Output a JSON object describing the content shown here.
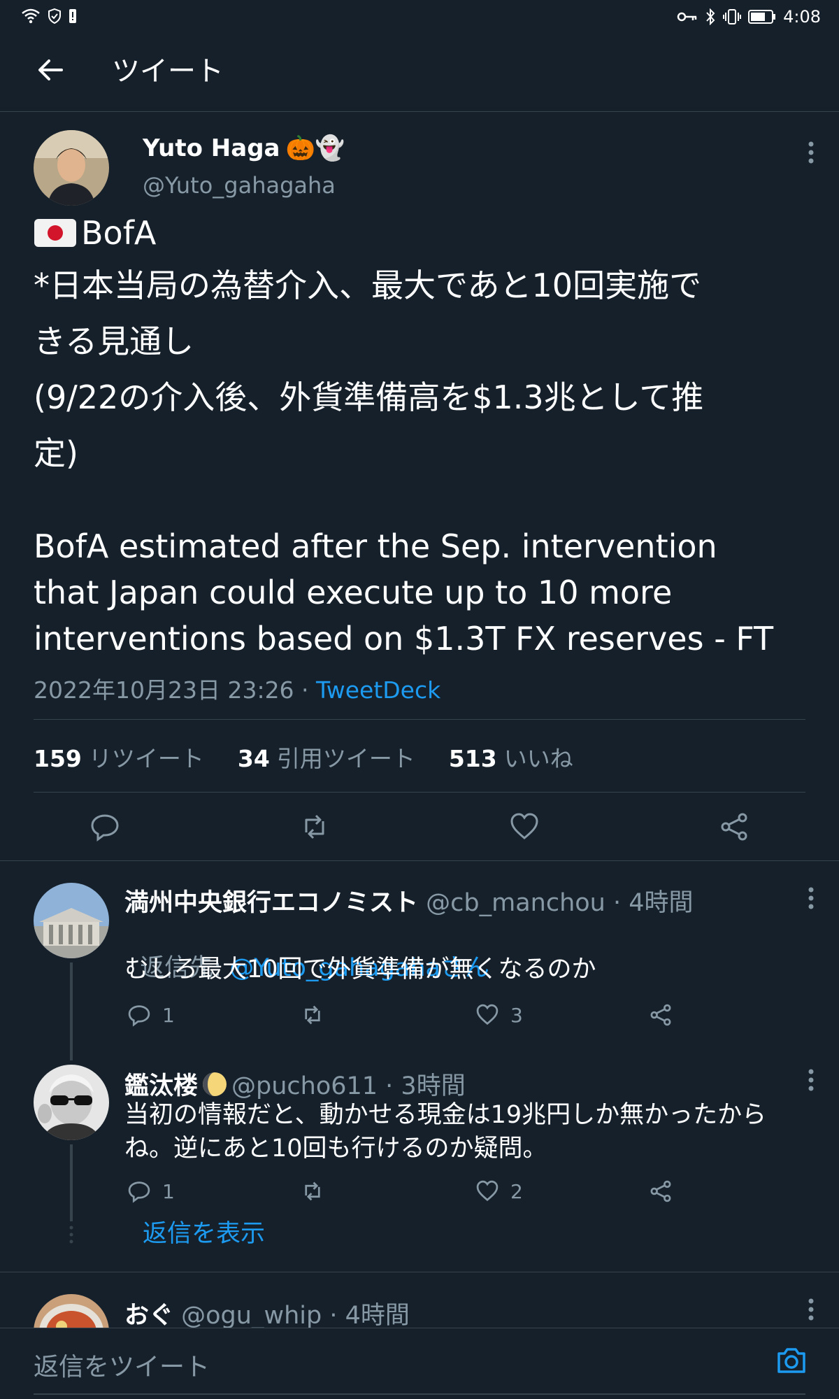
{
  "status_bar": {
    "time": "4:08"
  },
  "header": {
    "title": "ツイート"
  },
  "tweet": {
    "author_name": "Yuto Haga",
    "author_emoji": "🎃👻",
    "handle": "@Yuto_gahagaha",
    "flag_text": "BofA",
    "text_jp": "*日本当局の為替介入、最大であと10回実施で\nきる見通し\n(9/22の介入後、外貨準備高を$1.3兆として推\n定)",
    "text_en": "BofA estimated after the Sep. intervention\nthat Japan could execute up to 10 more\ninterventions based on $1.3T FX reserves - FT",
    "timestamp": "2022年10月23日 23:26 · ",
    "source": "TweetDeck",
    "retweets_count": "159",
    "retweets_label": "リツイート",
    "quotes_count": "34",
    "quotes_label": "引用ツイート",
    "likes_count": "513",
    "likes_label": "いいね"
  },
  "replies": [
    {
      "name": "満州中央銀行エコノミスト",
      "handle_time": " @cb_manchou · 4時間",
      "reply_to_prefix": "返信先: ",
      "reply_to_user": "@Yuto_gahagahaさん",
      "text": "むしろ最大10回で外貨準備が無くなるのか",
      "reply_count": "1",
      "like_count": "3"
    },
    {
      "name": "鑑汰楼",
      "handle_time": " @pucho611 · 3時間",
      "text": "当初の情報だと、動かせる現金は19兆円しか無かったから\nね。逆にあと10回も行けるのか疑問。",
      "reply_count": "1",
      "like_count": "2",
      "show_replies": "返信を表示"
    },
    {
      "name": "おぐ",
      "handle_time": " @ogu_whip · 4時間"
    }
  ],
  "compose": {
    "placeholder": "返信をツイート"
  },
  "colors": {
    "background": "#15202b",
    "accent": "#1d9bf0",
    "muted": "#8899a6",
    "border": "#38444d"
  }
}
